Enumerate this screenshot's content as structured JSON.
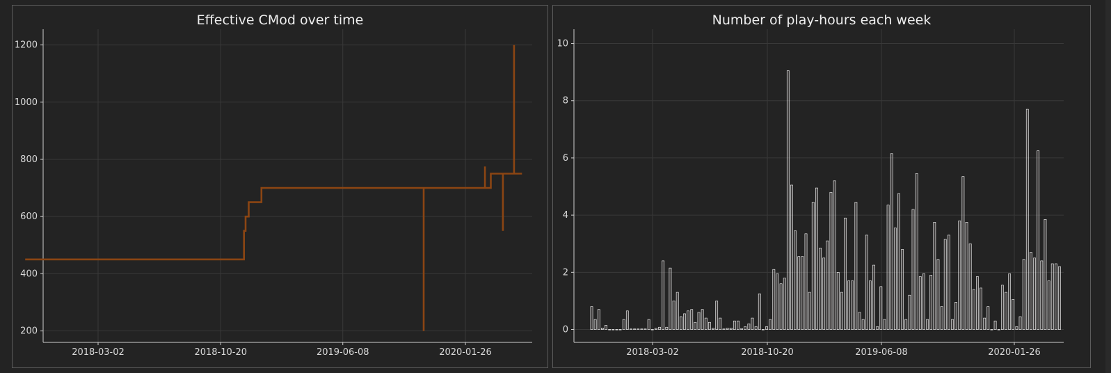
{
  "left_panel": {
    "title": "Effective CMod over time"
  },
  "right_panel": {
    "title": "Number of play-hours each week"
  },
  "chart_data": [
    {
      "type": "line",
      "title": "Effective CMod over time",
      "xlabel": "",
      "ylabel": "",
      "x_tick_labels": [
        "2018-03-02",
        "2018-10-20",
        "2019-06-08",
        "2020-01-26"
      ],
      "y_ticks": [
        200,
        400,
        600,
        800,
        1000,
        1200
      ],
      "ylim": [
        160,
        1255
      ],
      "grid": true,
      "line_color": "#8B4513",
      "series": [
        {
          "values": [
            {
              "x": "2017-10-15",
              "y": 450
            },
            {
              "x": "2018-12-03",
              "y": 450
            },
            {
              "x": "2018-12-03",
              "y": 550
            },
            {
              "x": "2018-12-06",
              "y": 550
            },
            {
              "x": "2018-12-06",
              "y": 600
            },
            {
              "x": "2018-12-12",
              "y": 600
            },
            {
              "x": "2018-12-12",
              "y": 650
            },
            {
              "x": "2019-01-05",
              "y": 650
            },
            {
              "x": "2019-01-05",
              "y": 700
            },
            {
              "x": "2019-11-08",
              "y": 700
            },
            {
              "x": "2019-11-08",
              "y": 200
            },
            {
              "x": "2019-11-08",
              "y": 700
            },
            {
              "x": "2020-03-03",
              "y": 700
            },
            {
              "x": "2020-03-03",
              "y": 775
            },
            {
              "x": "2020-03-03",
              "y": 700
            },
            {
              "x": "2020-03-14",
              "y": 700
            },
            {
              "x": "2020-03-14",
              "y": 750
            },
            {
              "x": "2020-04-06",
              "y": 750
            },
            {
              "x": "2020-04-06",
              "y": 550
            },
            {
              "x": "2020-04-06",
              "y": 750
            },
            {
              "x": "2020-04-27",
              "y": 750
            },
            {
              "x": "2020-04-27",
              "y": 1200
            },
            {
              "x": "2020-04-27",
              "y": 750
            },
            {
              "x": "2020-05-12",
              "y": 750
            }
          ]
        }
      ]
    },
    {
      "type": "bar",
      "title": "Number of play-hours each week",
      "xlabel": "",
      "ylabel": "",
      "x_tick_labels": [
        "2018-03-02",
        "2018-10-20",
        "2019-06-08",
        "2020-01-26"
      ],
      "y_ticks": [
        0,
        2,
        4,
        6,
        8,
        10
      ],
      "ylim": [
        -0.45,
        10.5
      ],
      "grid": true,
      "bar_fill": "#ece0dc",
      "bar_stroke": "#ffffff",
      "values": [
        0.8,
        0.35,
        0.7,
        0.05,
        0.15,
        0,
        0,
        0,
        0,
        0.35,
        0.65,
        0.02,
        0.02,
        0.02,
        0.02,
        0.02,
        0.35,
        0,
        0.05,
        0.08,
        2.4,
        0.08,
        2.15,
        1.0,
        1.3,
        0.45,
        0.55,
        0.65,
        0.7,
        0.25,
        0.6,
        0.7,
        0.4,
        0.25,
        0.05,
        1.0,
        0.4,
        0.02,
        0.05,
        0.05,
        0.3,
        0.3,
        0.03,
        0.1,
        0.2,
        0.4,
        0.1,
        1.25,
        0,
        0.1,
        0.35,
        2.1,
        1.95,
        1.6,
        1.8,
        9.05,
        5.05,
        3.45,
        2.55,
        2.55,
        3.35,
        1.3,
        4.45,
        4.95,
        2.85,
        2.5,
        3.1,
        4.8,
        5.2,
        2.0,
        1.3,
        3.9,
        1.7,
        1.7,
        4.45,
        0.6,
        0.35,
        3.3,
        1.7,
        2.25,
        0.1,
        1.5,
        0.35,
        4.35,
        6.15,
        3.55,
        4.75,
        2.8,
        0.35,
        1.2,
        4.2,
        5.45,
        1.85,
        1.95,
        0.35,
        1.9,
        3.75,
        2.45,
        0.8,
        3.15,
        3.3,
        0.35,
        0.95,
        3.8,
        5.35,
        3.75,
        3.0,
        1.4,
        1.85,
        1.45,
        0.4,
        0.8,
        0,
        0.3,
        0,
        1.55,
        1.3,
        1.95,
        1.05,
        0.1,
        0.45,
        2.45,
        7.7,
        2.7,
        2.5,
        6.25,
        2.4,
        3.85,
        1.7,
        2.3,
        2.3,
        2.2
      ]
    }
  ]
}
